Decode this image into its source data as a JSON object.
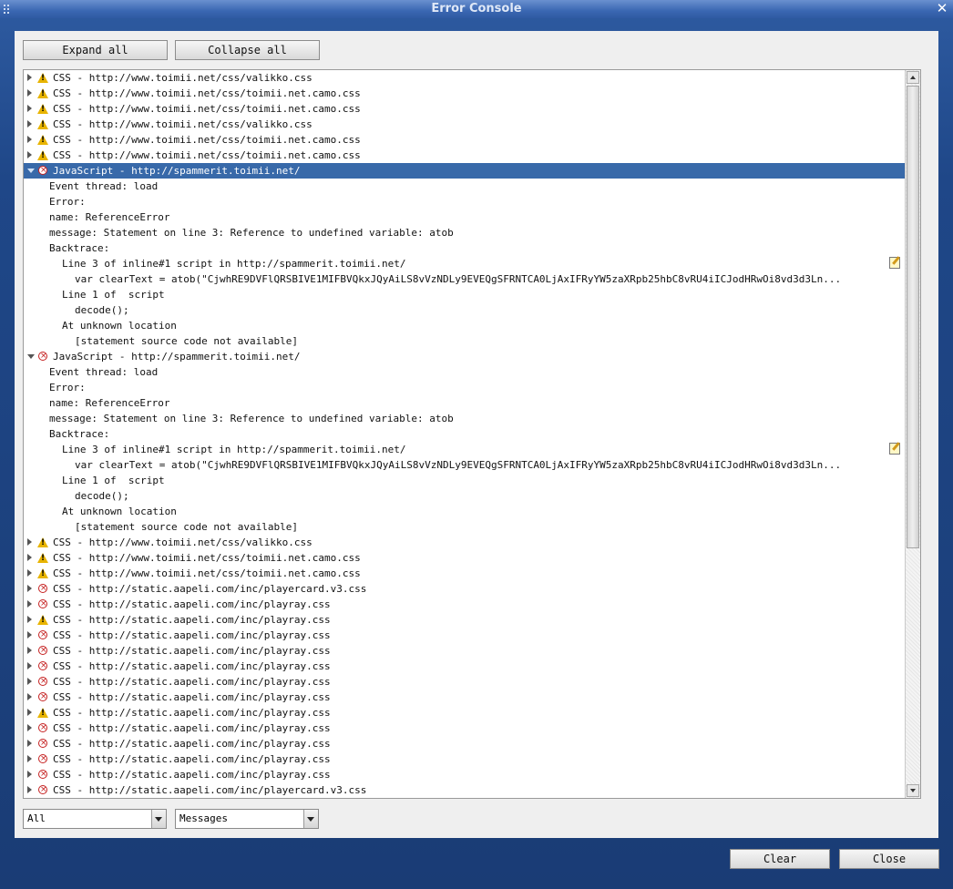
{
  "window": {
    "title": "Error Console"
  },
  "toolbar": {
    "expand_label": "Expand all",
    "collapse_label": "Collapse all"
  },
  "entries": [
    {
      "type": "warning",
      "kind": "CSS",
      "text": "CSS - http://www.toimii.net/css/valikko.css"
    },
    {
      "type": "warning",
      "kind": "CSS",
      "text": "CSS - http://www.toimii.net/css/toimii.net.camo.css"
    },
    {
      "type": "warning",
      "kind": "CSS",
      "text": "CSS - http://www.toimii.net/css/toimii.net.camo.css"
    },
    {
      "type": "warning",
      "kind": "CSS",
      "text": "CSS - http://www.toimii.net/css/valikko.css"
    },
    {
      "type": "warning",
      "kind": "CSS",
      "text": "CSS - http://www.toimii.net/css/toimii.net.camo.css"
    },
    {
      "type": "warning",
      "kind": "CSS",
      "text": "CSS - http://www.toimii.net/css/toimii.net.camo.css"
    },
    {
      "type": "error",
      "kind": "JavaScript",
      "text": "JavaScript - http://spammerit.toimii.net/",
      "expanded": true,
      "selected": true,
      "details": [
        {
          "d": 1,
          "text": "Event thread: load"
        },
        {
          "d": 1,
          "text": "Error:"
        },
        {
          "d": 1,
          "text": "name: ReferenceError"
        },
        {
          "d": 1,
          "text": "message: Statement on line 3: Reference to undefined variable: atob"
        },
        {
          "d": 1,
          "text": "Backtrace:"
        },
        {
          "d": 2,
          "text": "Line 3 of inline#1 script in http://spammerit.toimii.net/",
          "edit": true
        },
        {
          "d": 3,
          "text": "var clearText = atob(\"CjwhRE9DVFlQRSBIVE1MIFBVQkxJQyAiLS8vVzNDLy9EVEQgSFRNTCA0LjAxIFRyYW5zaXRpb25hbC8vRU4iICJodHRwOi8vd3d3Ln..."
        },
        {
          "d": 2,
          "text": "Line 1 of  script"
        },
        {
          "d": 3,
          "text": "decode();"
        },
        {
          "d": 2,
          "text": "At unknown location"
        },
        {
          "d": 3,
          "text": "[statement source code not available]"
        }
      ]
    },
    {
      "type": "error",
      "kind": "JavaScript",
      "text": "JavaScript - http://spammerit.toimii.net/",
      "expanded": true,
      "selected": false,
      "details": [
        {
          "d": 1,
          "text": "Event thread: load"
        },
        {
          "d": 1,
          "text": "Error:"
        },
        {
          "d": 1,
          "text": "name: ReferenceError"
        },
        {
          "d": 1,
          "text": "message: Statement on line 3: Reference to undefined variable: atob"
        },
        {
          "d": 1,
          "text": "Backtrace:"
        },
        {
          "d": 2,
          "text": "Line 3 of inline#1 script in http://spammerit.toimii.net/",
          "edit": true
        },
        {
          "d": 3,
          "text": "var clearText = atob(\"CjwhRE9DVFlQRSBIVE1MIFBVQkxJQyAiLS8vVzNDLy9EVEQgSFRNTCA0LjAxIFRyYW5zaXRpb25hbC8vRU4iICJodHRwOi8vd3d3Ln..."
        },
        {
          "d": 2,
          "text": "Line 1 of  script"
        },
        {
          "d": 3,
          "text": "decode();"
        },
        {
          "d": 2,
          "text": "At unknown location"
        },
        {
          "d": 3,
          "text": "[statement source code not available]"
        }
      ]
    },
    {
      "type": "warning",
      "kind": "CSS",
      "text": "CSS - http://www.toimii.net/css/valikko.css"
    },
    {
      "type": "warning",
      "kind": "CSS",
      "text": "CSS - http://www.toimii.net/css/toimii.net.camo.css"
    },
    {
      "type": "warning",
      "kind": "CSS",
      "text": "CSS - http://www.toimii.net/css/toimii.net.camo.css"
    },
    {
      "type": "error",
      "kind": "CSS",
      "text": "CSS - http://static.aapeli.com/inc/playercard.v3.css"
    },
    {
      "type": "error",
      "kind": "CSS",
      "text": "CSS - http://static.aapeli.com/inc/playray.css"
    },
    {
      "type": "warning",
      "kind": "CSS",
      "text": "CSS - http://static.aapeli.com/inc/playray.css"
    },
    {
      "type": "error",
      "kind": "CSS",
      "text": "CSS - http://static.aapeli.com/inc/playray.css"
    },
    {
      "type": "error",
      "kind": "CSS",
      "text": "CSS - http://static.aapeli.com/inc/playray.css"
    },
    {
      "type": "error",
      "kind": "CSS",
      "text": "CSS - http://static.aapeli.com/inc/playray.css"
    },
    {
      "type": "error",
      "kind": "CSS",
      "text": "CSS - http://static.aapeli.com/inc/playray.css"
    },
    {
      "type": "error",
      "kind": "CSS",
      "text": "CSS - http://static.aapeli.com/inc/playray.css"
    },
    {
      "type": "warning",
      "kind": "CSS",
      "text": "CSS - http://static.aapeli.com/inc/playray.css"
    },
    {
      "type": "error",
      "kind": "CSS",
      "text": "CSS - http://static.aapeli.com/inc/playray.css"
    },
    {
      "type": "error",
      "kind": "CSS",
      "text": "CSS - http://static.aapeli.com/inc/playray.css"
    },
    {
      "type": "error",
      "kind": "CSS",
      "text": "CSS - http://static.aapeli.com/inc/playray.css"
    },
    {
      "type": "error",
      "kind": "CSS",
      "text": "CSS - http://static.aapeli.com/inc/playray.css"
    },
    {
      "type": "error",
      "kind": "CSS",
      "text": "CSS - http://static.aapeli.com/inc/playercard.v3.css"
    }
  ],
  "filters": {
    "source_value": "All",
    "type_value": "Messages"
  },
  "footer": {
    "clear_label": "Clear",
    "close_label": "Close"
  },
  "icons": {
    "warning": "warning-triangle-icon",
    "error": "error-circle-icon"
  },
  "colors": {
    "selection": "#3869a9",
    "titlebar": "#3a67b2",
    "warning": "#e8b400",
    "error": "#c52020"
  }
}
